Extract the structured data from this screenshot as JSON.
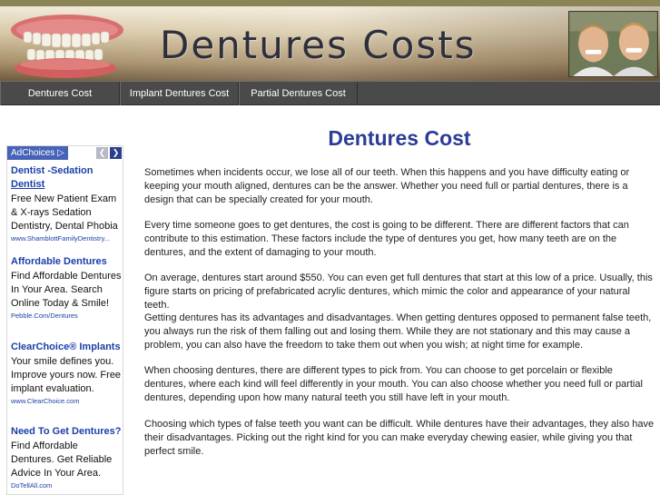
{
  "header": {
    "site_title": "Dentures Costs"
  },
  "nav": {
    "items": [
      {
        "label": "Dentures Cost"
      },
      {
        "label": "Implant Dentures Cost"
      },
      {
        "label": "Partial Dentures Cost"
      }
    ]
  },
  "ads": {
    "adchoices_label": "AdChoices",
    "items": [
      {
        "title_line1": "Dentist -Sedation",
        "title_line2": "Dentist",
        "text": "Free New Patient Exam & X-rays Sedation Dentistry, Dental Phobia",
        "url": "www.ShamblottFamilyDentistry..."
      },
      {
        "title": "Affordable Dentures",
        "text": "Find Affordable Dentures In Your Area. Search Online Today & Smile!",
        "url": "Pebble.Com/Dentures"
      },
      {
        "title": "ClearChoice® Implants",
        "text": "Your smile defines you. Improve yours now. Free implant evaluation.",
        "url": "www.ClearChoice.com"
      },
      {
        "title": "Need To Get Dentures?",
        "text": "Find Affordable Dentures. Get Reliable Advice In Your Area.",
        "url": "DoTellAll.com"
      }
    ]
  },
  "main": {
    "heading": "Dentures Cost",
    "paragraphs": [
      "Sometimes when incidents occur, we lose all of our teeth. When this happens and you have difficulty eating or keeping your mouth aligned, dentures can be the answer. Whether you need full or partial dentures, there is a design that can be specially created for your mouth.",
      "Every time someone goes to get dentures, the cost is going to be different. There are different factors that can contribute to this estimation. These factors include the type of dentures you get, how many teeth are on the dentures, and the extent of damaging to your mouth.",
      "On average, dentures start around $550. You can even get full dentures that start at this low of a price. Usually, this figure starts on pricing of prefabricated acrylic dentures, which mimic the color and appearance of your natural teeth.",
      "Getting dentures has its advantages and disadvantages. When getting dentures opposed to permanent false teeth, you always run the risk of them falling out and losing them. While they are not stationary and this may cause a problem, you can also have the freedom to take them out when you wish; at night time for example.",
      "When choosing dentures, there are different types to pick from. You can choose to get porcelain or flexible dentures, where each kind will feel differently in your mouth. You can also choose whether you need full or partial dentures, depending upon how many natural teeth you still have left in your mouth.",
      "Choosing which types of false teeth you want can be difficult. While dentures have their advantages, they also have their disadvantages. Picking out the right kind for you can make everyday chewing easier, while giving you that perfect smile."
    ]
  }
}
